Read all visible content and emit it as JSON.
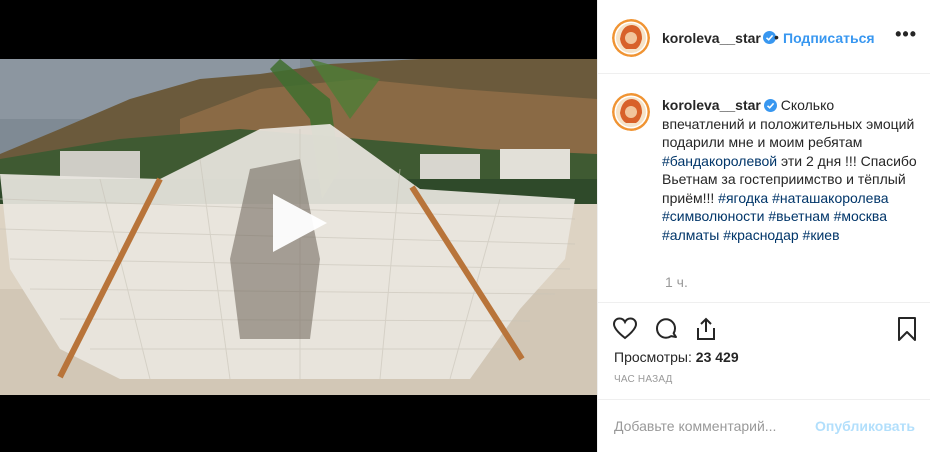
{
  "post": {
    "username": "koroleva__star",
    "follow_label": "Подписаться",
    "more_label": "•••",
    "dot": "•",
    "caption_text_1": "Сколько впечатлений и положительных эмоций подарили мне и моим ребятам",
    "tag_1": "#бандакоролевой",
    "caption_text_2": "эти 2 дня !!! Спасибо Вьетнам за гостеприимство и тёплый приём!!!",
    "tags": [
      "#ягодка",
      "#наташакоролева",
      "#символюности",
      "#вьетнам",
      "#москва",
      "#алматы",
      "#краснодар",
      "#киев"
    ],
    "time_relative": "1 ч.",
    "views_label": "Просмотры:",
    "views_count": "23 429",
    "time_ago": "ЧАС НАЗАД",
    "comment_placeholder": "Добавьте комментарий...",
    "publish_label": "Опубликовать"
  },
  "colors": {
    "link": "#3897f0",
    "hashtag": "#003569",
    "muted": "#999999",
    "publish_disabled": "#b2dffc"
  },
  "icons": [
    "play-icon",
    "verified-badge-icon",
    "heart-icon",
    "comment-icon",
    "share-icon",
    "bookmark-icon",
    "more-icon"
  ]
}
